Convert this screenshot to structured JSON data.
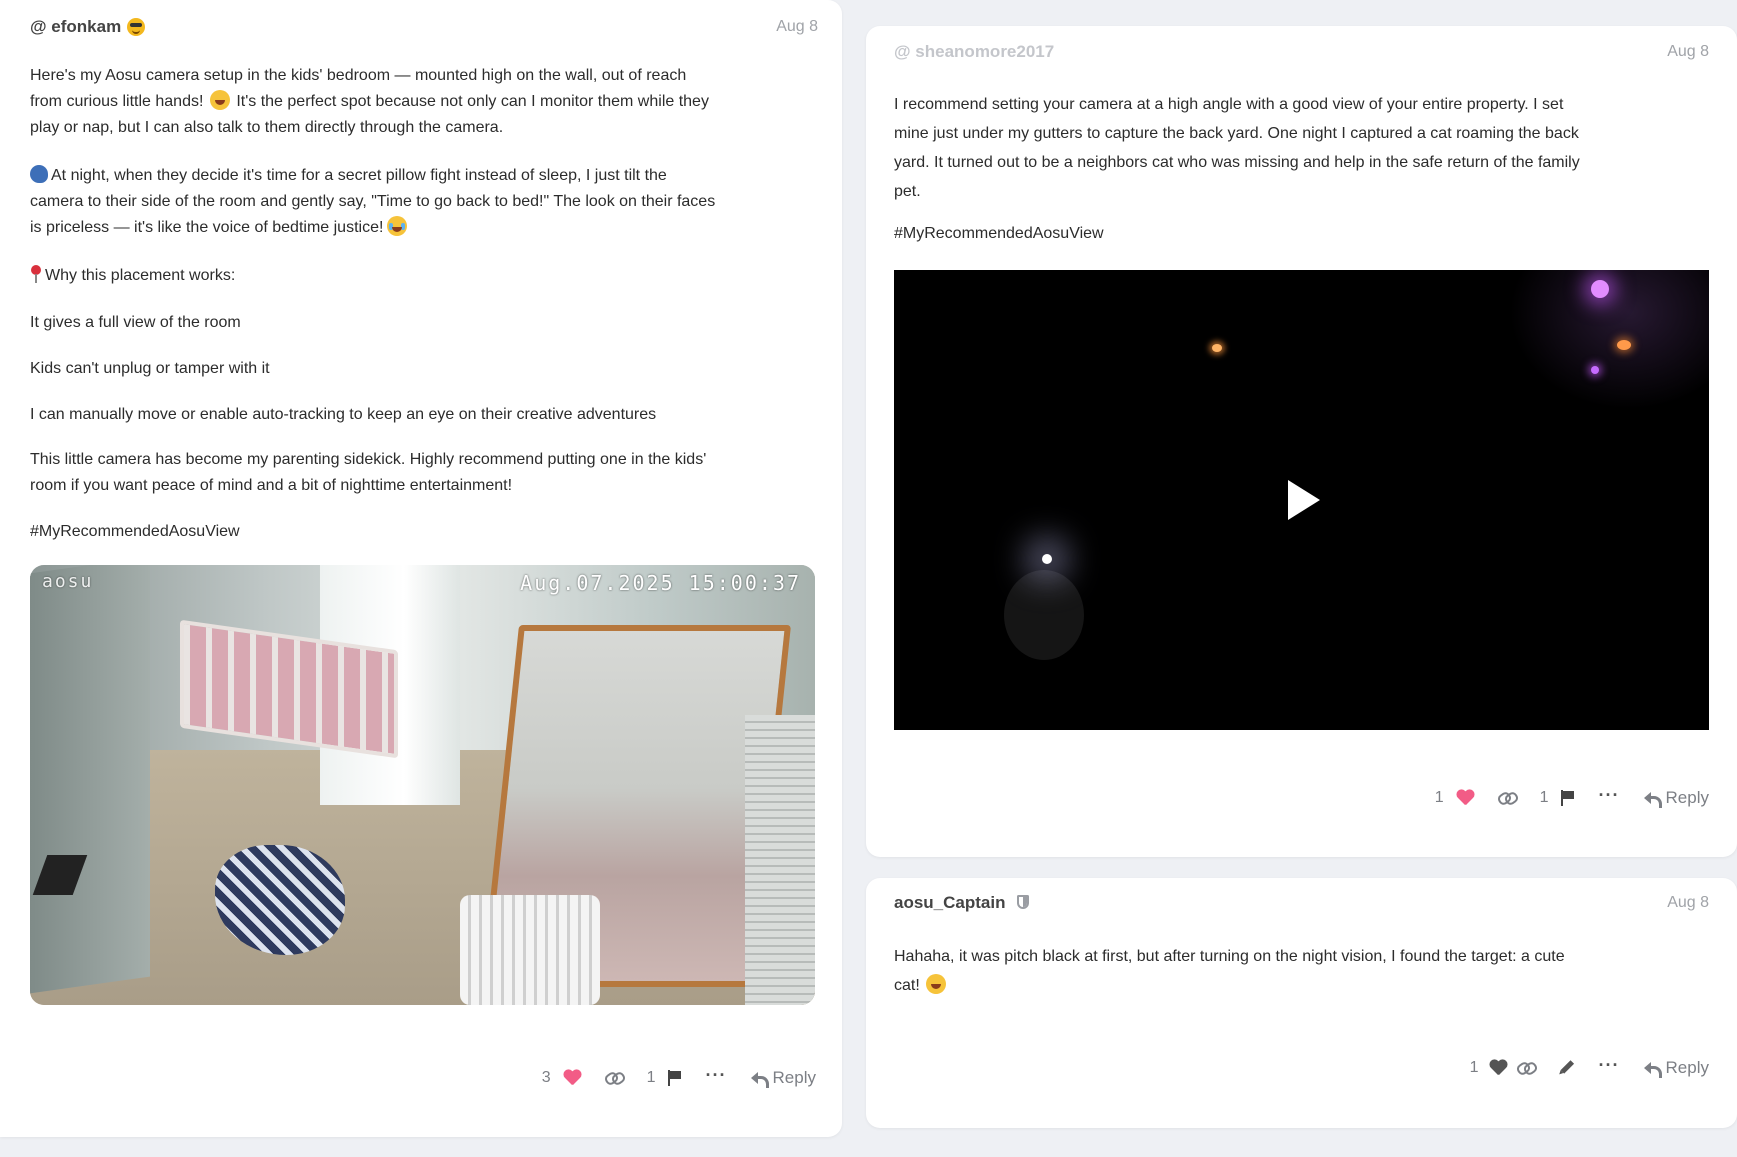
{
  "posts": {
    "left": {
      "username": "@ efonkam",
      "date": "Aug 8",
      "p1a": "Here's my Aosu camera setup in the kids' bedroom — mounted high on the wall, out of reach",
      "p1b": "from curious little hands!",
      "p1c": "It's the perfect spot because not only can I monitor them while they",
      "p1d": "play or nap, but I can also talk to them directly through the camera.",
      "p2a": "At night, when they decide it's time for a secret pillow fight instead of sleep, I just tilt the",
      "p2b": "camera to their side of the room and gently say, \"Time to go back to bed!\" The look on their faces",
      "p2c": "is priceless — it's like the voice of bedtime justice!",
      "p3": "Why this placement works:",
      "p4": "It gives a full view of the room",
      "p5": "Kids can't unplug or tamper with it",
      "p6": "I can manually move or enable auto-tracking to keep an eye on their creative adventures",
      "p7a": "This little camera has become my parenting sidekick. Highly recommend putting one in the kids'",
      "p7b": "room if you want peace of mind and a bit of nighttime entertainment!",
      "hashtag": "#MyRecommendedAosuView",
      "photo_brand": "aosu",
      "photo_timestamp": "Aug.07.2025 15:00:37",
      "likes": "3",
      "flags": "1",
      "reply_label": "Reply"
    },
    "right": {
      "username": "@ sheanomore2017",
      "date": "Aug 8",
      "l1": "I recommend setting your camera at a high angle with a good view of your entire property. I set",
      "l2": "mine just under my gutters to capture the back yard. One night I captured a cat roaming the back",
      "l3": "yard. It turned out to be a neighbors cat who was missing and help in the safe return of the family",
      "l4": "pet.",
      "hashtag": "#MyRecommendedAosuView",
      "likes": "1",
      "flags": "1",
      "reply_label": "Reply"
    },
    "reply": {
      "username": "aosu_Captain",
      "date": "Aug 8",
      "l1": "Hahaha, it was pitch black at first, but after turning on the night vision, I found the target: a cute",
      "l2": "cat!",
      "likes": "1",
      "reply_label": "Reply"
    }
  },
  "colors": {
    "heart_pink": "#f25c86",
    "background": "#eef0f4",
    "card": "#ffffff"
  },
  "icons": [
    "sunglasses-emoji",
    "grinning-emoji",
    "speaking-head-emoji",
    "laughing-tears-emoji",
    "pin-emoji",
    "heart-icon",
    "link-icon",
    "flag-icon",
    "more-icon",
    "reply-icon",
    "pencil-icon",
    "shield-icon",
    "play-icon",
    "smiling-emoji"
  ]
}
